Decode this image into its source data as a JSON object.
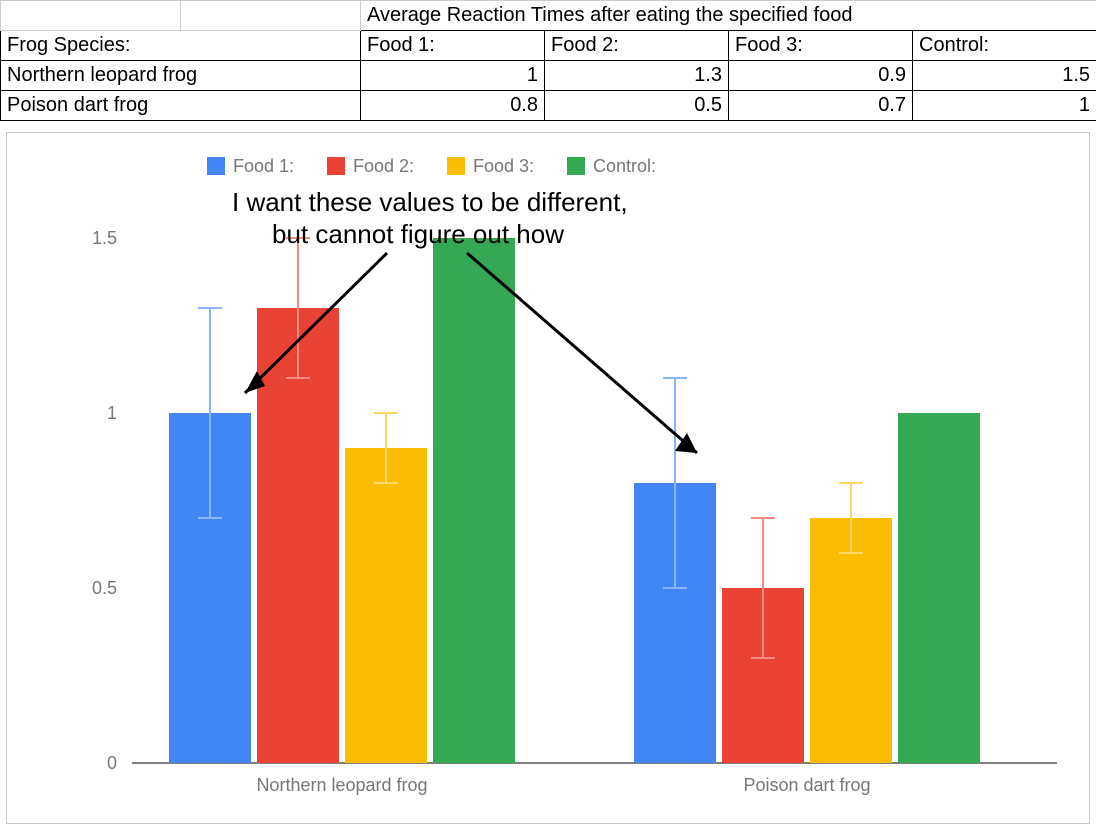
{
  "table": {
    "header_title": "Average Reaction Times after eating the specified food",
    "row_label": "Frog Species:",
    "col1": "Food 1:",
    "col2": "Food 2:",
    "col3": "Food 3:",
    "col4": "Control:",
    "species1": "Northern leopard frog",
    "species2": "Poison dart frog",
    "s1f1": "1",
    "s1f2": "1.3",
    "s1f3": "0.9",
    "s1c": "1.5",
    "s2f1": "0.8",
    "s2f2": "0.5",
    "s2f3": "0.7",
    "s2c": "1"
  },
  "legend": {
    "l1": "Food 1:",
    "l2": "Food 2:",
    "l3": "Food 3:",
    "l4": "Control:"
  },
  "axis": {
    "t0": "0",
    "t05": "0.5",
    "t1": "1",
    "t15": "1.5",
    "cat1": "Northern leopard frog",
    "cat2": "Poison dart frog"
  },
  "annotation": {
    "line1": "I want these values to be different,",
    "line2": "but cannot figure out how"
  },
  "colors": {
    "food1": "#4285F4",
    "food2": "#EA4335",
    "food3": "#FBBC04",
    "control": "#34A853",
    "errbar": "#4285F4"
  },
  "chart_data": {
    "type": "bar",
    "title": "",
    "xlabel": "",
    "ylabel": "",
    "ylim": [
      0,
      1.6
    ],
    "categories": [
      "Northern leopard frog",
      "Poison dart frog"
    ],
    "series": [
      {
        "name": "Food 1:",
        "color": "#4285F4",
        "values": [
          1.0,
          0.8
        ],
        "error": [
          0.3,
          0.3
        ]
      },
      {
        "name": "Food 2:",
        "color": "#EA4335",
        "values": [
          1.3,
          0.5
        ],
        "error": [
          0.2,
          0.2
        ]
      },
      {
        "name": "Food 3:",
        "color": "#FBBC04",
        "values": [
          0.9,
          0.7
        ],
        "error": [
          0.1,
          0.1
        ]
      },
      {
        "name": "Control:",
        "color": "#34A853",
        "values": [
          1.5,
          1.0
        ],
        "error": [
          0.0,
          0.0
        ]
      }
    ],
    "annotation": "I want these values to be different, but cannot figure out how",
    "annotation_targets": [
      {
        "category": "Northern leopard frog",
        "series": "Food 1:"
      },
      {
        "category": "Poison dart frog",
        "series": "Food 1:"
      }
    ]
  }
}
